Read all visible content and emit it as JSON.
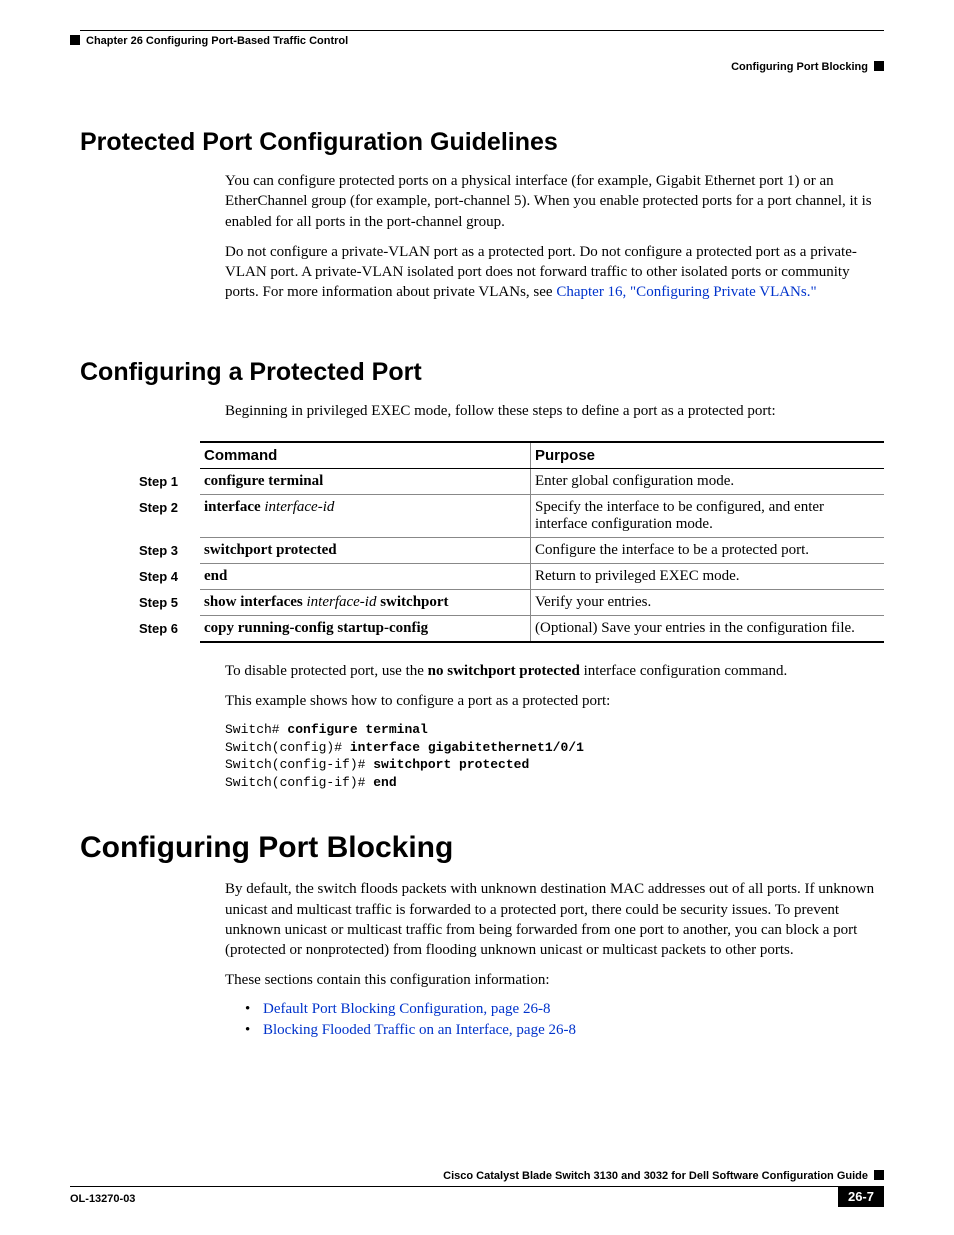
{
  "header": {
    "chapter_line": "Chapter 26      Configuring Port-Based Traffic Control",
    "section_right": "Configuring Port Blocking"
  },
  "s1": {
    "title": "Protected Port Configuration Guidelines",
    "p1": "You can configure protected ports on a physical interface (for example, Gigabit Ethernet port 1) or an EtherChannel group (for example, port-channel 5). When you enable protected ports for a port channel, it is enabled for all ports in the port-channel group.",
    "p2a": "Do not configure a private-VLAN port as a protected port. Do not configure a protected port as a private-VLAN port. A private-VLAN isolated port does not forward traffic to other isolated ports or community ports. For more information about private VLANs, see ",
    "p2link": "Chapter 16, \"Configuring Private VLANs.\""
  },
  "s2": {
    "title": "Configuring a Protected Port",
    "intro": "Beginning in privileged EXEC mode, follow these steps to define a port as a protected port:",
    "th_cmd": "Command",
    "th_purpose": "Purpose",
    "rows": [
      {
        "step": "Step 1",
        "cmd_bold": "configure terminal",
        "cmd_ital": "",
        "cmd_bold2": "",
        "purpose": "Enter global configuration mode."
      },
      {
        "step": "Step 2",
        "cmd_bold": "interface",
        "cmd_ital": " interface-id",
        "cmd_bold2": "",
        "purpose": "Specify the interface to be configured, and enter interface configuration mode."
      },
      {
        "step": "Step 3",
        "cmd_bold": "switchport protected",
        "cmd_ital": "",
        "cmd_bold2": "",
        "purpose": "Configure the interface to be a protected port."
      },
      {
        "step": "Step 4",
        "cmd_bold": "end",
        "cmd_ital": "",
        "cmd_bold2": "",
        "purpose": "Return to privileged EXEC mode."
      },
      {
        "step": "Step 5",
        "cmd_bold": "show interfaces",
        "cmd_ital": " interface-id",
        "cmd_bold2": " switchport",
        "purpose": "Verify your entries."
      },
      {
        "step": "Step 6",
        "cmd_bold": "copy running-config startup-config",
        "cmd_ital": "",
        "cmd_bold2": "",
        "purpose": "(Optional) Save your entries in the configuration file."
      }
    ],
    "after1a": "To disable protected port, use the ",
    "after1b": "no switchport protected",
    "after1c": " interface configuration command.",
    "after2": "This example shows how to configure a port as a protected port:",
    "cli": {
      "l1p": "Switch# ",
      "l1b": "configure terminal",
      "l2p": "Switch(config)# ",
      "l2b": "interface gigabitethernet1/0/1",
      "l3p": "Switch(config-if)# ",
      "l3b": "switchport protected",
      "l4p": "Switch(config-if)# ",
      "l4b": "end"
    }
  },
  "s3": {
    "title": "Configuring Port Blocking",
    "p1": "By default, the switch floods packets with unknown destination MAC addresses out of all ports. If unknown unicast and multicast traffic is forwarded to a protected port, there could be security issues. To prevent unknown unicast or multicast traffic from being forwarded from one port to another, you can block a port (protected or nonprotected) from flooding unknown unicast or multicast packets to other ports.",
    "p2": "These sections contain this configuration information:",
    "links": [
      "Default Port Blocking Configuration, page 26-8",
      "Blocking Flooded Traffic on an Interface, page 26-8"
    ]
  },
  "footer": {
    "book": "Cisco Catalyst Blade Switch 3130 and 3032 for Dell Software Configuration Guide",
    "docnum": "OL-13270-03",
    "pagenum": "26-7"
  }
}
